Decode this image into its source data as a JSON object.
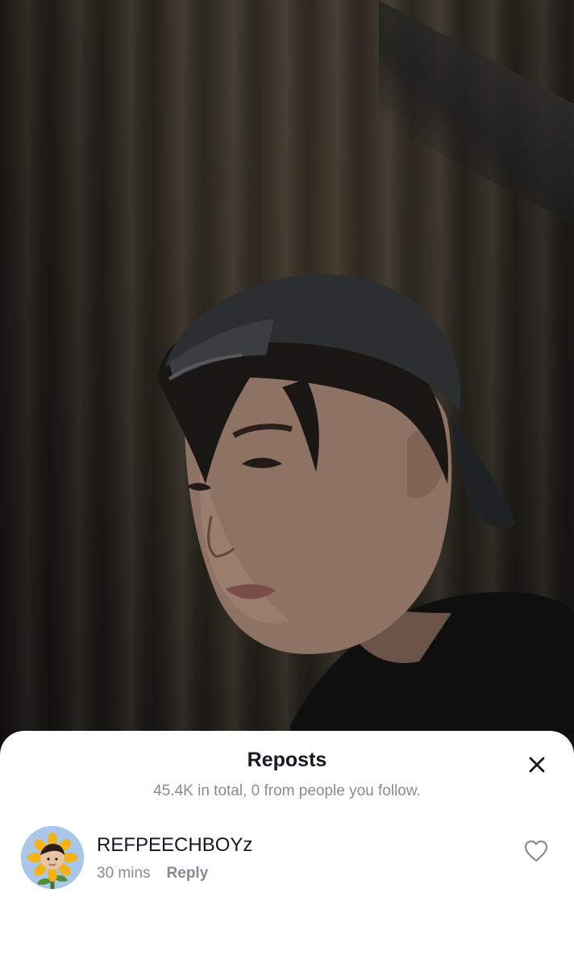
{
  "sheet": {
    "title": "Reposts",
    "subtitle": "45.4K in total, 0 from people you follow.",
    "close_icon": "close-icon"
  },
  "reposts": [
    {
      "username": "REFPEECHBOYz",
      "time": "30 mins",
      "reply_label": "Reply",
      "avatar_icon": "sunflower-avatar",
      "like_icon": "heart-outline-icon"
    }
  ],
  "colors": {
    "sheet_bg": "#ffffff",
    "primary_text": "#161823",
    "secondary_text": "#8a8b91",
    "avatar_bg": "#a9c7e8"
  }
}
